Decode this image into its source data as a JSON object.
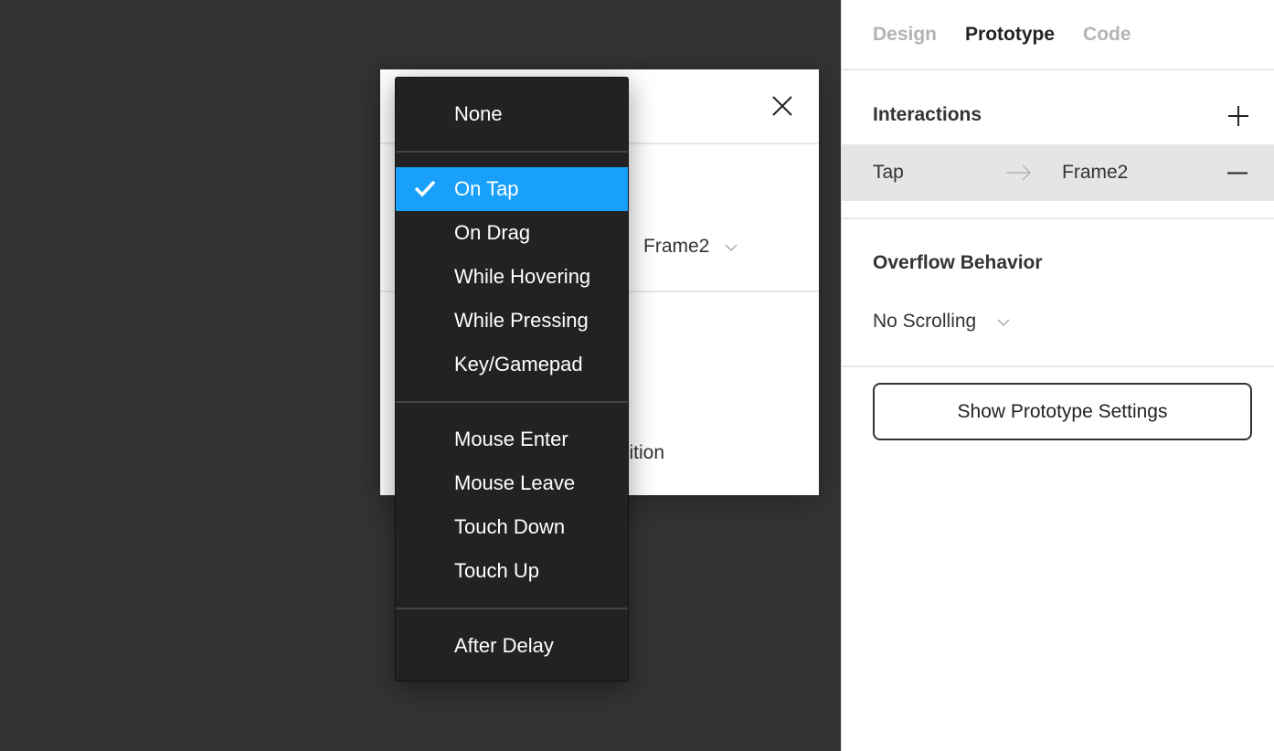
{
  "panel": {
    "tabs": [
      {
        "label": "Design",
        "active": false
      },
      {
        "label": "Prototype",
        "active": true
      },
      {
        "label": "Code",
        "active": false
      }
    ],
    "interactions_title": "Interactions",
    "interaction": {
      "trigger": "Tap",
      "destination": "Frame2"
    },
    "overflow_title": "Overflow Behavior",
    "overflow_value": "No Scrolling",
    "settings_button": "Show Prototype Settings"
  },
  "modal": {
    "destination": "Frame2",
    "partial_text": "sition"
  },
  "menu": {
    "groups": [
      [
        "None"
      ],
      [
        "On Tap",
        "On Drag",
        "While Hovering",
        "While Pressing",
        "Key/Gamepad"
      ],
      [
        "Mouse Enter",
        "Mouse Leave",
        "Touch Down",
        "Touch Up"
      ],
      [
        "After Delay"
      ]
    ],
    "selected": "On Tap",
    "accent": "#18a0fb"
  }
}
